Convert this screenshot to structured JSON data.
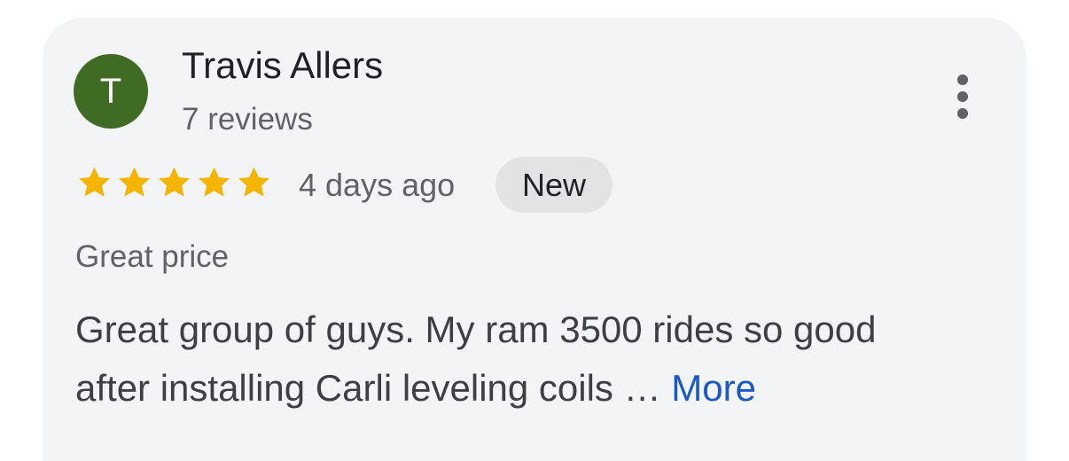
{
  "review": {
    "avatar_initial": "T",
    "avatar_color": "#3f6b24",
    "reviewer_name": "Travis Allers",
    "reviewer_meta": "7 reviews",
    "rating": 5,
    "rating_max": 5,
    "star_color": "#f4b400",
    "time_ago": "4 days ago",
    "badge": "New",
    "tag": "Great price",
    "text_line1": "Great group of guys. My ram 3500 rides so good",
    "text_line2": "after installing Carli leveling coils …",
    "more_label": "More",
    "more_link_color": "#1a57c7",
    "menu_icon": "more-vert-icon"
  }
}
